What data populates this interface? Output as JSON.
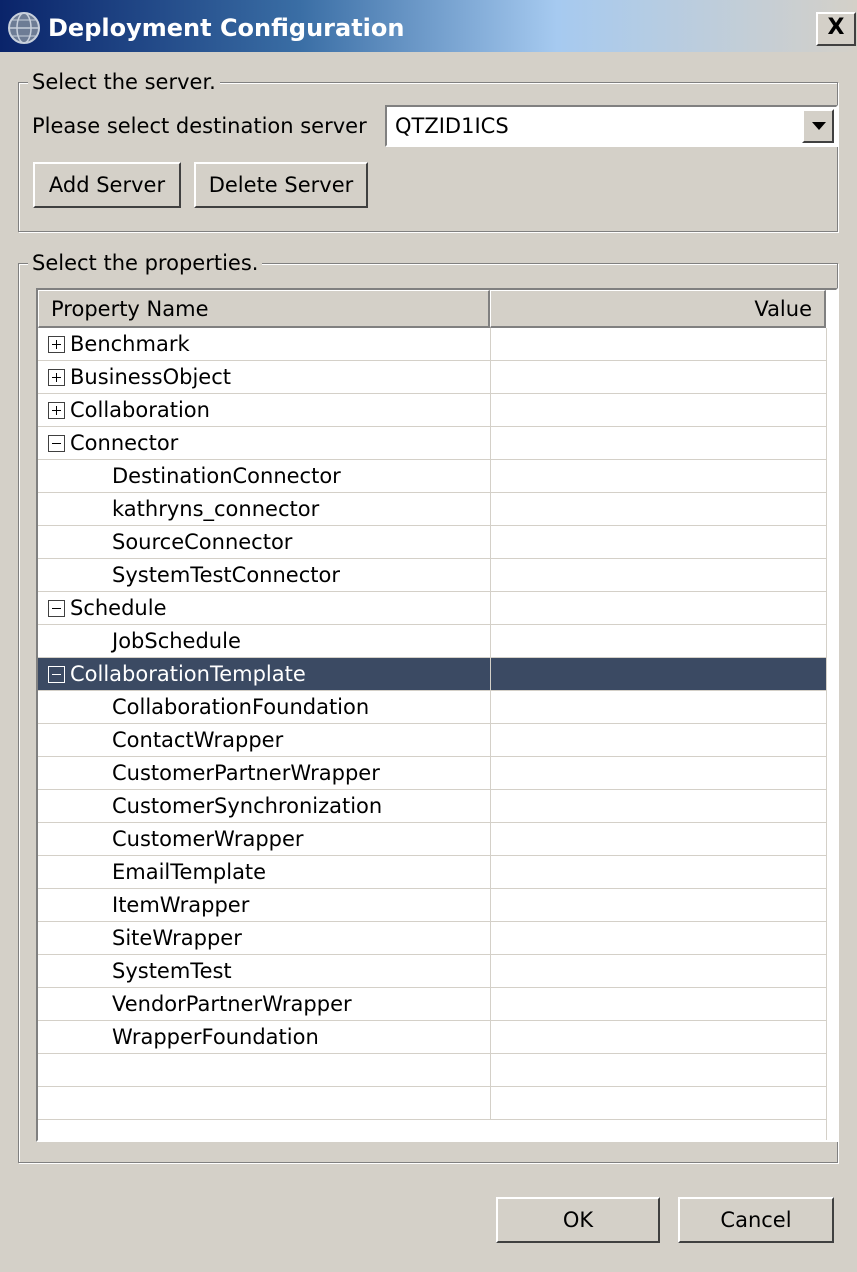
{
  "window": {
    "title": "Deployment Configuration",
    "close_label": "X"
  },
  "server_group": {
    "legend": "Select the server.",
    "dest_label": "Please select destination server",
    "dest_value": "QTZID1ICS",
    "add_button": "Add Server",
    "delete_button": "Delete Server"
  },
  "properties_group": {
    "legend": "Select the properties.",
    "col_name": "Property Name",
    "col_value": "Value"
  },
  "rows": [
    {
      "label": "Benchmark",
      "expander": "plus"
    },
    {
      "label": "BusinessObject",
      "expander": "plus"
    },
    {
      "label": "Collaboration",
      "expander": "plus"
    },
    {
      "label": "Connector",
      "expander": "minus"
    },
    {
      "label": "DestinationConnector"
    },
    {
      "label": "kathryns_connector"
    },
    {
      "label": "SourceConnector"
    },
    {
      "label": "SystemTestConnector"
    },
    {
      "label": "Schedule",
      "expander": "minus"
    },
    {
      "label": "JobSchedule"
    },
    {
      "label": "CollaborationTemplate",
      "expander": "minus",
      "selected": true
    },
    {
      "label": "CollaborationFoundation"
    },
    {
      "label": "ContactWrapper"
    },
    {
      "label": "CustomerPartnerWrapper"
    },
    {
      "label": "CustomerSynchronization"
    },
    {
      "label": "CustomerWrapper"
    },
    {
      "label": "EmailTemplate"
    },
    {
      "label": "ItemWrapper"
    },
    {
      "label": "SiteWrapper"
    },
    {
      "label": "SystemTest"
    },
    {
      "label": "VendorPartnerWrapper"
    },
    {
      "label": "WrapperFoundation"
    },
    {
      "label": ""
    },
    {
      "label": ""
    }
  ],
  "footer": {
    "ok_button": "OK",
    "cancel_button": "Cancel"
  },
  "colors": {
    "selection": "#3b4a63",
    "face": "#d4d0c8",
    "title_start": "#0a246a"
  }
}
